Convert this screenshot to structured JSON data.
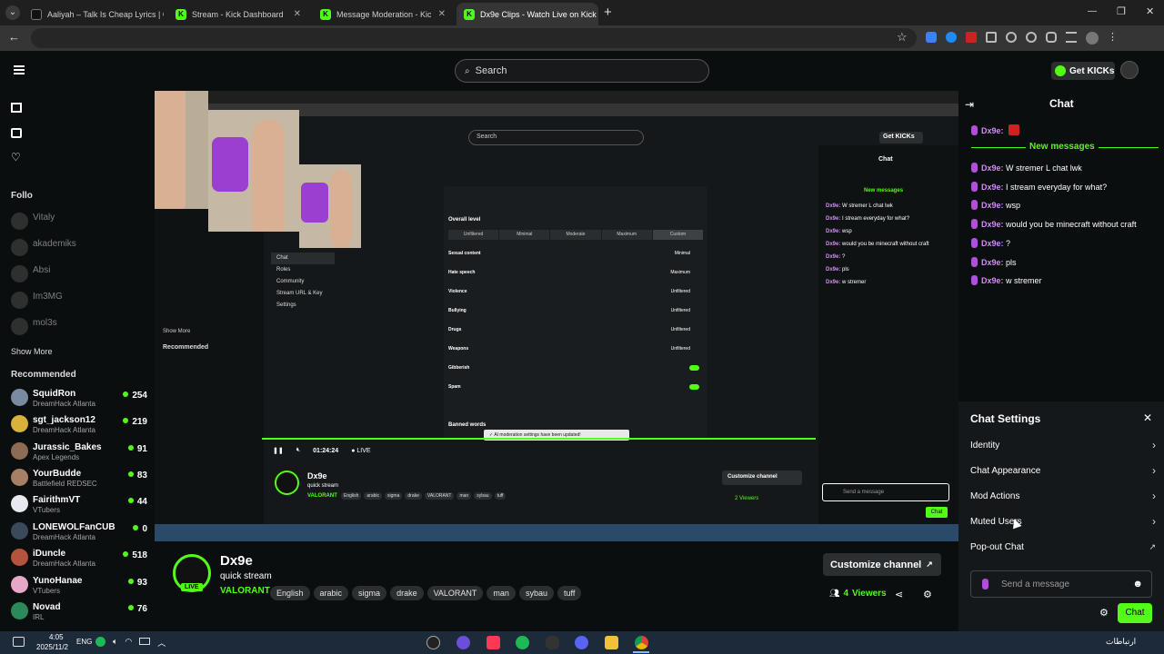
{
  "browser": {
    "tabs": [
      {
        "title": "Aaliyah – Talk Is Cheap Lyrics | G"
      },
      {
        "title": "Stream - Kick Dashboard"
      },
      {
        "title": "Message Moderation - Kick Da"
      },
      {
        "title": "Dx9e Clips - Watch Live on Kick",
        "active": true
      }
    ],
    "new_tab": "+",
    "window_controls": [
      "⌄",
      "—",
      "❐",
      "✕"
    ]
  },
  "kick": {
    "search_placeholder": "Search",
    "get_kicks_label": "Get KICKs",
    "sidebar": {
      "following_label": "Follo",
      "following": [
        {
          "name": "Vitaly"
        },
        {
          "name": "akademiks"
        },
        {
          "name": "Absi"
        },
        {
          "name": "Im3MG"
        },
        {
          "name": "mol3s"
        }
      ],
      "show_more": "Show More",
      "recommended_label": "Recommended",
      "recommended": [
        {
          "name": "SquidRon",
          "category": "DreamHack Atlanta",
          "viewers": "254"
        },
        {
          "name": "sgt_jackson12",
          "category": "DreamHack Atlanta",
          "viewers": "219"
        },
        {
          "name": "Jurassic_Bakes",
          "category": "Apex Legends",
          "viewers": "91"
        },
        {
          "name": "YourBudde",
          "category": "Battlefield REDSEC",
          "viewers": "83"
        },
        {
          "name": "FairithmVT",
          "category": "VTubers",
          "viewers": "44"
        },
        {
          "name": "LONEWOLFanCUB",
          "category": "DreamHack Atlanta",
          "viewers": "0"
        },
        {
          "name": "iDuncle",
          "category": "DreamHack Atlanta",
          "viewers": "518"
        },
        {
          "name": "YunoHanae",
          "category": "VTubers",
          "viewers": "93"
        },
        {
          "name": "Novad",
          "category": "IRL",
          "viewers": "76"
        }
      ]
    },
    "channel": {
      "name": "Dx9e",
      "title": "quick stream",
      "category": "VALORANT",
      "live_badge": "LIVE",
      "tags": [
        "English",
        "arabic",
        "sigma",
        "drake",
        "VALORANT",
        "man",
        "sybau",
        "tuff"
      ],
      "customize_label": "Customize channel",
      "viewers": "4",
      "viewers_label": "Viewers"
    },
    "chat": {
      "title": "Chat",
      "new_messages": "New messages",
      "messages": [
        {
          "user": "Dx9e:",
          "text": "W stremer L chat lwk"
        },
        {
          "user": "Dx9e:",
          "text": "I stream everyday for what?"
        },
        {
          "user": "Dx9e:",
          "text": "wsp"
        },
        {
          "user": "Dx9e:",
          "text": "would you be minecraft without craft"
        },
        {
          "user": "Dx9e:",
          "text": "?"
        },
        {
          "user": "Dx9e:",
          "text": "pls"
        },
        {
          "user": "Dx9e:",
          "text": "w stremer"
        }
      ],
      "first_user": "Dx9e:",
      "settings": {
        "title": "Chat Settings",
        "items": [
          "Identity",
          "Chat Appearance",
          "Mod Actions",
          "Muted Users",
          "Pop-out Chat"
        ]
      },
      "input_placeholder": "Send a message",
      "send_label": "Chat"
    },
    "nested_stream": {
      "time": "01:24:24",
      "live": "LIVE",
      "channel": "Dx9e",
      "title": "quick stream",
      "category": "VALORANT",
      "viewers": "2 Viewers",
      "customize": "Customize channel",
      "moderation": {
        "overall_level": "Overall level",
        "levels": [
          "Unfiltered",
          "Minimal",
          "Moderate",
          "Maximum",
          "Custom"
        ],
        "categories": [
          {
            "name": "Sexual content",
            "value": "Minimal"
          },
          {
            "name": "Hate speech",
            "value": "Maximum"
          },
          {
            "name": "Violence",
            "value": "Unfiltered"
          },
          {
            "name": "Bullying",
            "value": "Unfiltered"
          },
          {
            "name": "Drugs",
            "value": "Unfiltered"
          },
          {
            "name": "Weapons",
            "value": "Unfiltered"
          },
          {
            "name": "Gibberish",
            "value": ""
          },
          {
            "name": "Spam",
            "value": ""
          }
        ],
        "banned_words": "Banned words",
        "toast": "AI moderation settings have been updated!",
        "settings_menu": [
          "Chat",
          "Roles",
          "Community",
          "Stream URL & Key",
          "Settings"
        ]
      }
    }
  },
  "taskbar": {
    "lang": "ENG",
    "date": "2025/11/2",
    "time": "4:05",
    "right_text": "ارتباطات"
  },
  "colors": {
    "kick_green": "#53fc18",
    "chat_user": "#d28cf5",
    "bg": "#0b0e0f"
  }
}
